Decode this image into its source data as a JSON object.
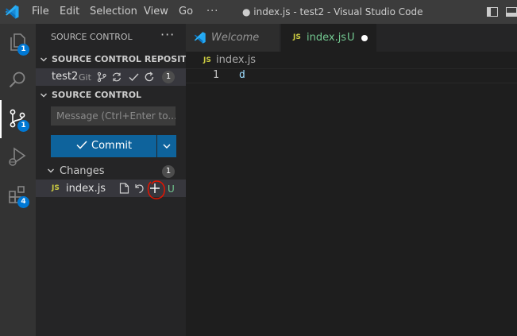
{
  "titlebar": {
    "menu": [
      "File",
      "Edit",
      "Selection",
      "View",
      "Go"
    ],
    "more": "···",
    "title": "● index.js - test2 - Visual Studio Code"
  },
  "activity_bar": {
    "explorer_badge": "1",
    "scm_badge": "1",
    "extensions_badge": "4"
  },
  "sidebar": {
    "title": "SOURCE CONTROL",
    "more": "···",
    "repositories_header": "SOURCE CONTROL REPOSITOR...",
    "repo": {
      "name": "test2",
      "provider": "Git",
      "count": "1"
    },
    "scm_header": "SOURCE CONTROL",
    "message_placeholder": "Message (Ctrl+Enter to...",
    "commit_label": "Commit",
    "changes": {
      "label": "Changes",
      "count": "1",
      "files": [
        {
          "icon": "JS",
          "name": "index.js",
          "status": "U"
        }
      ]
    }
  },
  "editor": {
    "tabs": [
      {
        "label": "Welcome"
      },
      {
        "icon": "JS",
        "label": "index.js",
        "status": "U"
      }
    ],
    "breadcrumb": {
      "icon": "JS",
      "file": "index.js"
    },
    "lines": [
      {
        "number": "1",
        "text": "d"
      }
    ]
  },
  "colors": {
    "accent": "#0e639c",
    "badge": "#0078d4",
    "js_icon": "#cbcb41",
    "untracked": "#73c991",
    "annotation": "#e51400"
  },
  "icons": [
    "vscode-logo-icon",
    "files-icon",
    "search-icon",
    "source-control-icon",
    "run-debug-icon",
    "extensions-icon",
    "layout-sidebar-icon",
    "layout-panel-icon",
    "chevron-down-icon",
    "branch-icon",
    "sync-icon",
    "check-icon",
    "refresh-icon",
    "open-file-icon",
    "discard-icon",
    "stage-plus-icon",
    "close-dot-icon"
  ]
}
